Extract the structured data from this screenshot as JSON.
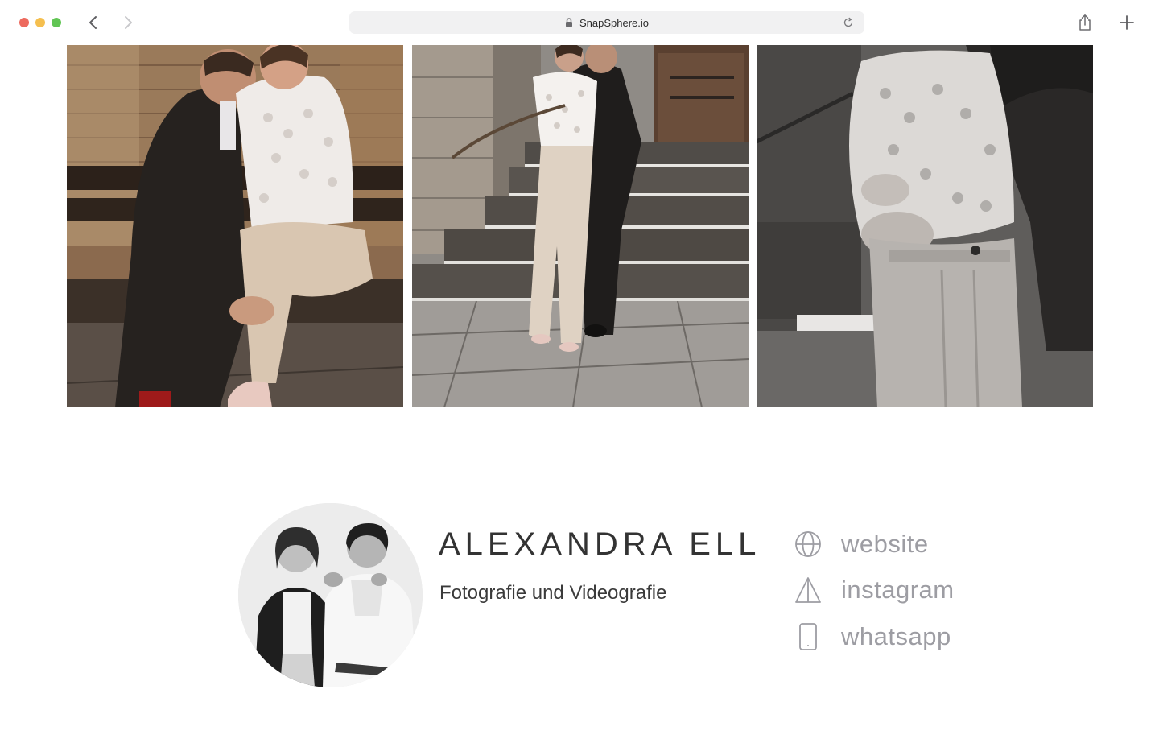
{
  "browser": {
    "url": "SnapSphere.io"
  },
  "gallery": {
    "photos": [
      {
        "icon": "photo-couple-bench"
      },
      {
        "icon": "photo-couple-steps"
      },
      {
        "icon": "photo-couple-embrace-bw"
      }
    ]
  },
  "profile": {
    "name": "ALEXANDRA ELL",
    "tagline": "Fotografie und Videografie",
    "avatar_icon": "avatar-duo-photo"
  },
  "links": [
    {
      "icon": "globe-icon",
      "label": "website"
    },
    {
      "icon": "instagram-icon",
      "label": "instagram"
    },
    {
      "icon": "phone-icon",
      "label": "whatsapp"
    }
  ],
  "colors": {
    "link_text": "#9d9da3",
    "name_text": "#333333",
    "address_bar": "#f1f1f2"
  }
}
